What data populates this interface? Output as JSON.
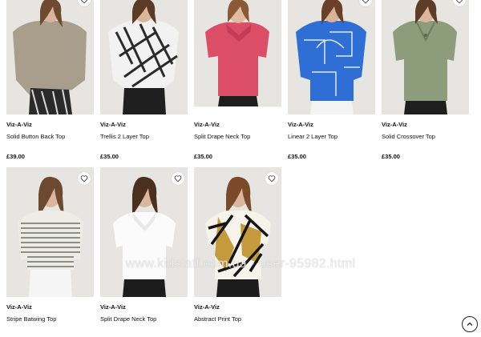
{
  "products": [
    {
      "brand": "Viz-A-Viz",
      "name": "Solid Button Back Top",
      "price": "£39.00"
    },
    {
      "brand": "Viz-A-Viz",
      "name": "Trellis 2 Layer Top",
      "price": "£35.00"
    },
    {
      "brand": "Viz-A-Viz",
      "name": "Split Drape Neck Top",
      "price": "£35.00"
    },
    {
      "brand": "Viz-A-Viz",
      "name": "Linear 2 Layer Top",
      "price": "£35.00"
    },
    {
      "brand": "Viz-A-Viz",
      "name": "Solid Crossover Top",
      "price": "£35.00"
    },
    {
      "brand": "Viz-A-Viz",
      "name": "Stripe Batwing Top"
    },
    {
      "brand": "Viz-A-Viz",
      "name": "Split Drape Neck Top"
    },
    {
      "brand": "Viz-A-Viz",
      "name": "Abstract Print Top"
    }
  ],
  "watermark": "www.kidstaff.com.ua  ·  user-95982.html",
  "icons": {
    "favourite": "heart-outline-icon",
    "scroll_top": "chevron-up-circle-icon"
  },
  "colors": {
    "image_bg": "#e6e4e1",
    "text": "#111111"
  }
}
